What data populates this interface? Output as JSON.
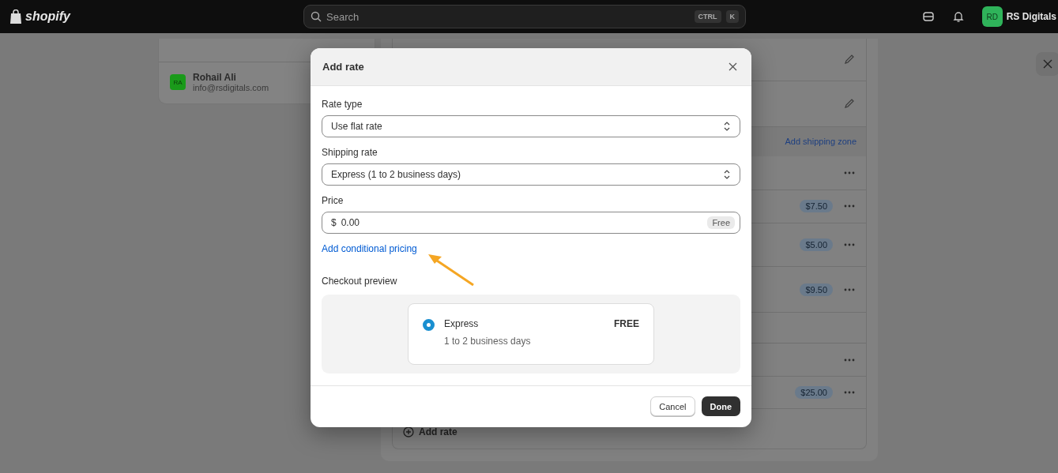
{
  "topbar": {
    "logo": "shopify",
    "search": {
      "placeholder": "Search",
      "keys": [
        "CTRL",
        "K"
      ]
    },
    "account": {
      "initials": "RD",
      "name": "RS Digitals"
    }
  },
  "sidebar": {
    "user": {
      "initials": "RA",
      "name": "Rohail Ali",
      "email": "info@rsdigitals.com"
    }
  },
  "shipping": {
    "rows": [
      {
        "kind": "edit"
      },
      {
        "kind": "edit"
      },
      {
        "kind": "header",
        "link": "Add shipping zone"
      },
      {
        "kind": "rate"
      },
      {
        "kind": "rate",
        "price": "$7.50"
      },
      {
        "kind": "rate",
        "price": "$5.00"
      },
      {
        "kind": "rate",
        "price": "$9.50"
      },
      {
        "kind": "gap"
      },
      {
        "kind": "rate"
      },
      {
        "kind": "rate",
        "price": "$25.00"
      }
    ],
    "add_rate": "Add rate"
  },
  "modal": {
    "title": "Add rate",
    "rate_type": {
      "label": "Rate type",
      "value": "Use flat rate"
    },
    "shipping_rate": {
      "label": "Shipping rate",
      "value": "Express (1 to 2 business days)"
    },
    "price": {
      "label": "Price",
      "currency": "$",
      "value": "0.00",
      "badge": "Free"
    },
    "conditional_link": "Add conditional pricing",
    "preview": {
      "label": "Checkout preview",
      "option": {
        "name": "Express",
        "detail": "1 to 2 business days",
        "price": "FREE",
        "selected": true
      }
    },
    "buttons": {
      "cancel": "Cancel",
      "done": "Done"
    }
  }
}
